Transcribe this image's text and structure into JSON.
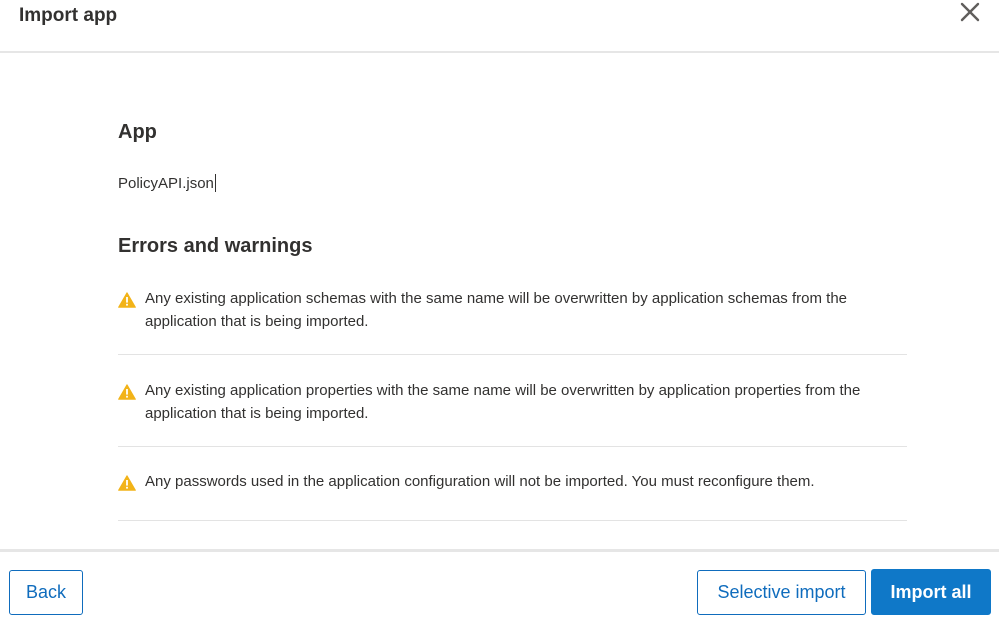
{
  "dialog": {
    "title": "Import app",
    "close_icon": "close-icon"
  },
  "app_section": {
    "heading": "App",
    "file_name": "PolicyAPI.json"
  },
  "errors_section": {
    "heading": "Errors and warnings",
    "warnings": [
      {
        "icon": "warning-icon",
        "text": "Any existing application schemas with the same name will be overwritten by application schemas from the application that is being imported."
      },
      {
        "icon": "warning-icon",
        "text": "Any existing application properties with the same name will be overwritten by application properties from the application that is being imported."
      },
      {
        "icon": "warning-icon",
        "text": "Any passwords used in the application configuration will not be imported. You must reconfigure them."
      }
    ]
  },
  "footer": {
    "back_label": "Back",
    "selective_import_label": "Selective import",
    "import_all_label": "Import all"
  },
  "colors": {
    "accent": "#0f6cbd",
    "primary_button": "#0f78c8",
    "warning": "#f2b318"
  }
}
